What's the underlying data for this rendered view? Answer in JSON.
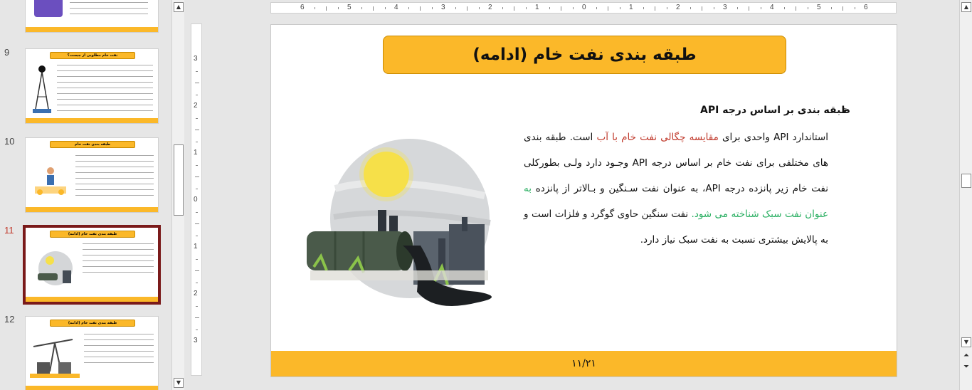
{
  "thumbnails": [
    {
      "num": "",
      "title": "",
      "active": false
    },
    {
      "num": "9",
      "title": "نفت خام مطلوبی از چیست؟",
      "active": false
    },
    {
      "num": "10",
      "title": "طبقه بندی نفت خام",
      "active": false
    },
    {
      "num": "11",
      "title": "طبقه بندی نفت خام (ادامه)",
      "active": true
    },
    {
      "num": "12",
      "title": "طبقه بندی نفت خام (ادامه)",
      "active": false
    }
  ],
  "ruler": {
    "horizontal": [
      "6",
      "5",
      "4",
      "3",
      "2",
      "1",
      "0",
      "1",
      "2",
      "3",
      "4",
      "5",
      "6"
    ],
    "vertical": [
      "3",
      "2",
      "1",
      "0",
      "1",
      "2",
      "3"
    ]
  },
  "slide": {
    "title": "طبقه بندی نفت خام (ادامه)",
    "bullet": "طبقه بندی بر اساس درجه  API",
    "bullet_marker": "➢",
    "body": {
      "p1": "استاندارد  API  واحدی برای ",
      "p1_red": "مقایسه چگالی نفت خام با آب",
      "p2": " است. طبقه بندی های مختلفی برای نفت خام بر اساس درجه API  وجـود دارد ولـی بطورکلی نفت خام زیر پانزده درجه  API، به عنوان نفت سـنگین و بـالاتر از پانزده ",
      "p2_green": "به عنوان نفت سبک شناخته می شود.",
      "p3": " نفت سنگین حاوی گوگرد و فلزات است و به پالایش بیشتری نسبت به نفت سبک نیاز دارد."
    },
    "footer": "۱۱/۲۱"
  },
  "colors": {
    "accent": "#fbb829",
    "active_thumb_border": "#7a1a1a",
    "highlight_red": "#c0392b",
    "highlight_green": "#27ae60"
  },
  "icons": {
    "scroll_up": "triangle-up-icon",
    "scroll_down": "triangle-down-icon"
  }
}
